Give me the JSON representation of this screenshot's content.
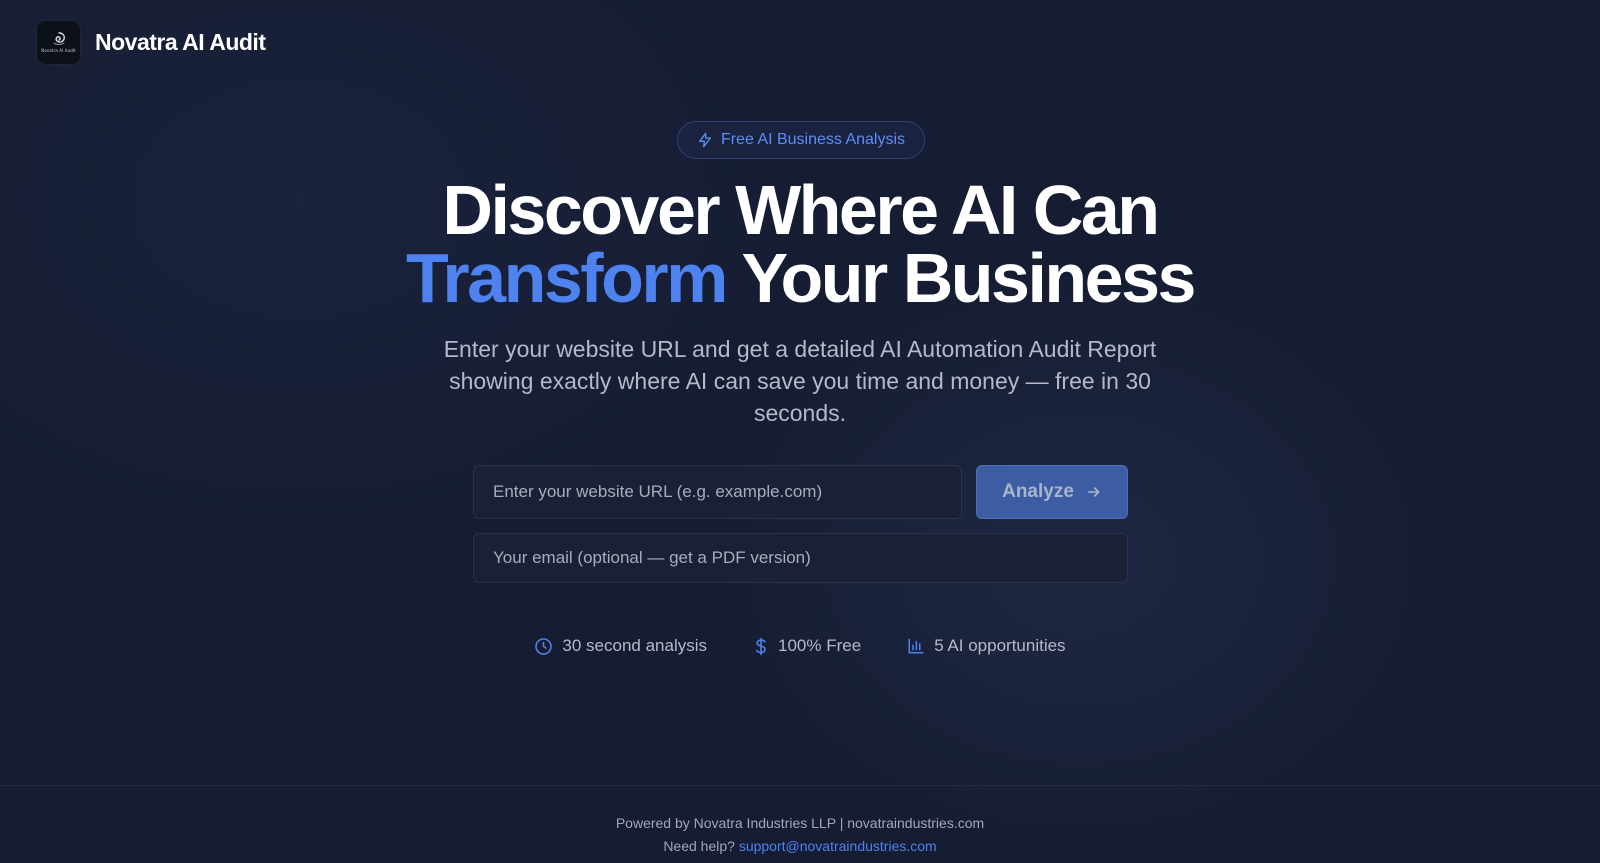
{
  "header": {
    "logo_text": "Novatra AI Audit",
    "brand": "Novatra AI Audit"
  },
  "hero": {
    "badge": "Free AI Business Analysis",
    "headline_line1": "Discover Where AI Can",
    "headline_accent": "Transform",
    "headline_line2_rest": " Your Business",
    "subtext": "Enter your website URL and get a detailed AI Automation Audit Report showing exactly where AI can save you time and money — free in 30 seconds."
  },
  "form": {
    "url_placeholder": "Enter your website URL (e.g. example.com)",
    "url_value": "",
    "analyze_label": "Analyze",
    "email_placeholder": "Your email (optional — get a PDF version)",
    "email_value": ""
  },
  "features": [
    {
      "icon": "clock-icon",
      "label": "30 second analysis"
    },
    {
      "icon": "dollar-icon",
      "label": "100% Free"
    },
    {
      "icon": "bar-chart-icon",
      "label": "5 AI opportunities"
    }
  ],
  "footer": {
    "powered_by": "Powered by Novatra Industries LLP | novatraindustries.com",
    "help_prefix": "Need help? ",
    "support_email": "support@novatraindustries.com"
  },
  "colors": {
    "background": "#161d33",
    "accent": "#4d82ef",
    "button": "#3c5ca3"
  }
}
